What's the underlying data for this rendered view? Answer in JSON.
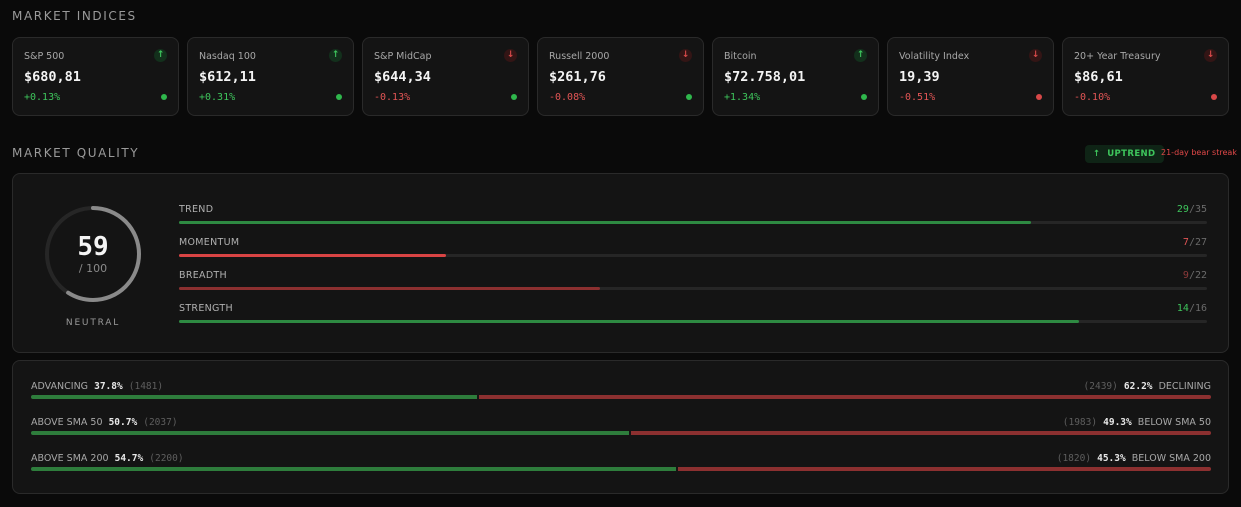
{
  "indices_title": "MARKET INDICES",
  "quality_title": "MARKET QUALITY",
  "colors": {
    "positive": "#3ec55c",
    "negative": "#e25555",
    "strong_neg": "#e04848",
    "muted_neg": "#8c3030",
    "bar_green": "#2e7d3c"
  },
  "cards": [
    {
      "name": "S&P 500",
      "price": "$680,81",
      "change": "+0.13%",
      "direction": "up"
    },
    {
      "name": "Nasdaq 100",
      "price": "$612,11",
      "change": "+0.31%",
      "direction": "up"
    },
    {
      "name": "S&P MidCap",
      "price": "$644,34",
      "change": "-0.13%",
      "direction": "down"
    },
    {
      "name": "Russell 2000",
      "price": "$261,76",
      "change": "-0.08%",
      "direction": "down"
    },
    {
      "name": "Bitcoin",
      "price": "$72.758,01",
      "change": "+1.34%",
      "direction": "up"
    },
    {
      "name": "Volatility Index",
      "price": "19,39",
      "change": "-0.51%",
      "direction": "down"
    },
    {
      "name": "20+ Year Treasury",
      "price": "$86,61",
      "change": "-0.10%",
      "direction": "down"
    }
  ],
  "trend_badge": {
    "arrow": "↑",
    "label": "UPTREND"
  },
  "streak": "21-day bear streak",
  "score": {
    "value": "59",
    "total": "/ 100",
    "label": "NEUTRAL",
    "fraction": 0.59
  },
  "metrics": [
    {
      "label": "TREND",
      "score": "29",
      "max": "/35",
      "fraction": 0.8286,
      "color": "#2e8a42",
      "score_color": "#3ec55c"
    },
    {
      "label": "MOMENTUM",
      "score": "7",
      "max": "/27",
      "fraction": 0.2593,
      "color": "#d94444",
      "score_color": "#e25555"
    },
    {
      "label": "BREADTH",
      "score": "9",
      "max": "/22",
      "fraction": 0.4091,
      "color": "#8c3030",
      "score_color": "#8c3a3a"
    },
    {
      "label": "STRENGTH",
      "score": "14",
      "max": "/16",
      "fraction": 0.875,
      "color": "#2e8a42",
      "score_color": "#3ec55c"
    }
  ],
  "breadth": [
    {
      "left_label": "ADVANCING",
      "left_pct": "37.8%",
      "left_count": "(1481)",
      "right_count": "(2439)",
      "right_pct": "62.2%",
      "right_label": "DECLINING",
      "fraction": 0.378
    },
    {
      "left_label": "ABOVE  SMA 50",
      "left_pct": "50.7%",
      "left_count": "(2037)",
      "right_count": "(1983)",
      "right_pct": "49.3%",
      "right_label": "BELOW  SMA 50",
      "fraction": 0.507
    },
    {
      "left_label": "ABOVE  SMA 200",
      "left_pct": "54.7%",
      "left_count": "(2200)",
      "right_count": "(1820)",
      "right_pct": "45.3%",
      "right_label": "BELOW  SMA 200",
      "fraction": 0.547
    }
  ]
}
